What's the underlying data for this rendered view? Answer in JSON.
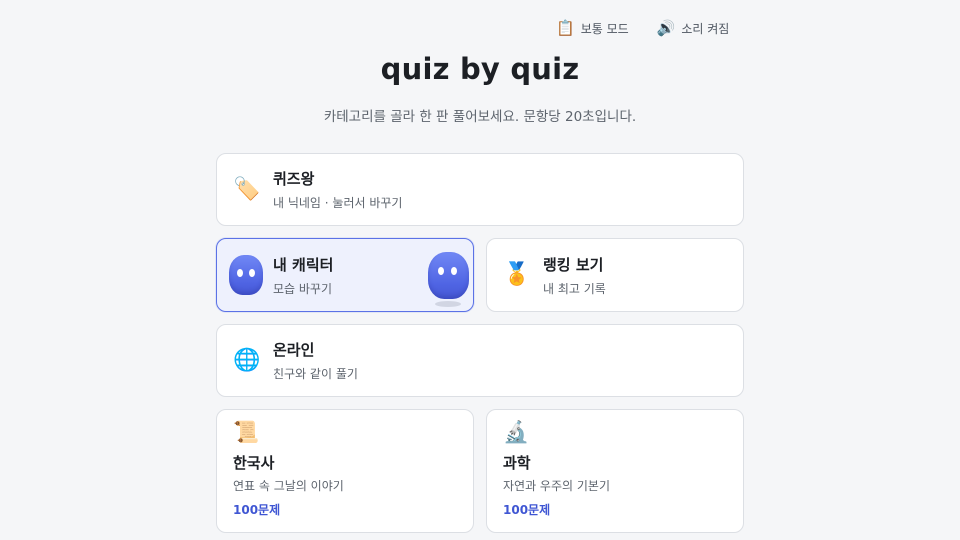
{
  "toolbar": {
    "mode_icon": "clipboard-icon",
    "mode_label": "보통 모드",
    "sound_icon": "speaker-icon",
    "sound_label": "소리 켜짐"
  },
  "header": {
    "title": "quiz by quiz",
    "subtitle": "카테고리를 골라 한 판 풀어보세요. 문항당 20초입니다."
  },
  "profile": {
    "icon": "tag-icon",
    "title": "퀴즈왕",
    "desc": "내 닉네임 · 눌러서 바꾸기"
  },
  "character": {
    "title": "내 캐릭터",
    "desc": "모습 바꾸기",
    "color": "#5b72e6"
  },
  "ranking": {
    "icon": "medal-icon",
    "title": "랭킹 보기",
    "desc": "내 최고 기록"
  },
  "online": {
    "icon": "globe-icon",
    "title": "온라인",
    "desc": "친구와 같이 풀기"
  },
  "categories": [
    {
      "icon": "scroll-icon",
      "title": "한국사",
      "desc": "연표 속 그날의 이야기",
      "count": "100문제"
    },
    {
      "icon": "microscope-icon",
      "title": "과학",
      "desc": "자연과 우주의 기본기",
      "count": "100문제"
    }
  ],
  "colors": {
    "accent": "#3f56d3",
    "background": "#f5f6f8",
    "card": "#ffffff",
    "selected_bg": "#eef1fd"
  }
}
